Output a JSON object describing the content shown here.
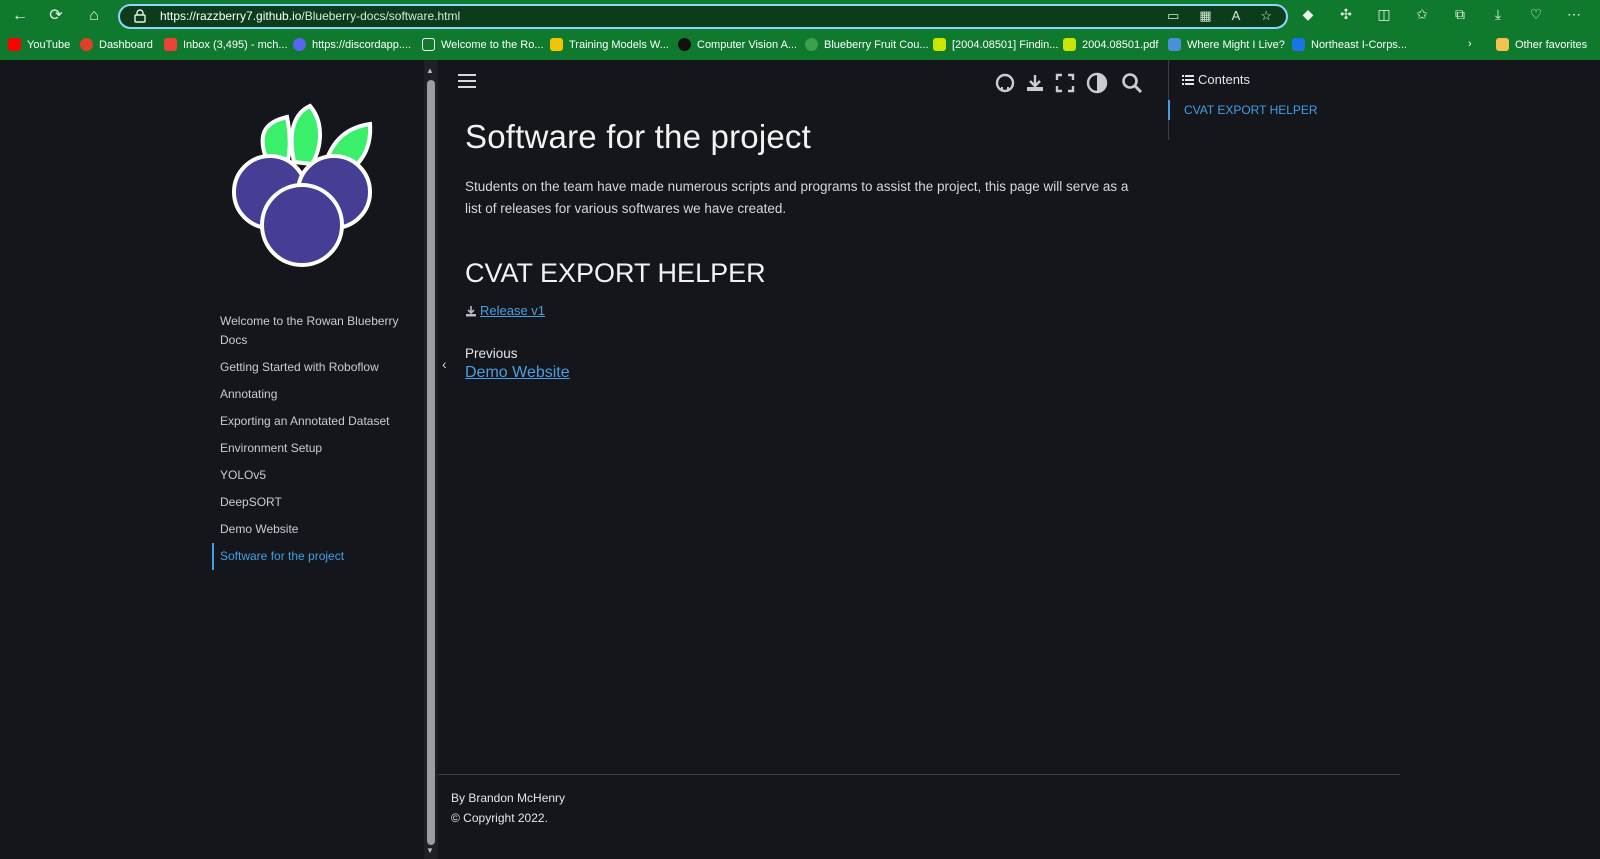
{
  "browser": {
    "url_host": "https://razzberry7.github.io",
    "url_path": "/Blueberry-docs/software.html"
  },
  "favorites": [
    {
      "label": "YouTube",
      "color": "#ff0000"
    },
    {
      "label": "Dashboard",
      "color": "#e0402a"
    },
    {
      "label": "Inbox (3,495) - mch...",
      "color": "#ea4335"
    },
    {
      "label": "https://discordapp....",
      "color": "#5865f2"
    },
    {
      "label": "Welcome to the Ro...",
      "color": "#ffffff"
    },
    {
      "label": "Training Models W...",
      "color": "#f5c400"
    },
    {
      "label": "Computer Vision A...",
      "color": "#111111"
    },
    {
      "label": "Blueberry Fruit Cou...",
      "color": "#3aa14a"
    },
    {
      "label": "[2004.08501] Findin...",
      "color": "#c8e600"
    },
    {
      "label": "2004.08501.pdf",
      "color": "#c8e600"
    },
    {
      "label": "Where Might I Live?",
      "color": "#4a90d9"
    },
    {
      "label": "Northeast I-Corps...",
      "color": "#1a73e8"
    },
    {
      "label": "Other favorites",
      "color": "#f2c14e"
    }
  ],
  "sidebar": {
    "items": [
      {
        "label": "Welcome to the Rowan Blueberry Docs"
      },
      {
        "label": "Getting Started with Roboflow"
      },
      {
        "label": "Annotating"
      },
      {
        "label": "Exporting an Annotated Dataset"
      },
      {
        "label": "Environment Setup"
      },
      {
        "label": "YOLOv5"
      },
      {
        "label": "DeepSORT"
      },
      {
        "label": "Demo Website"
      },
      {
        "label": "Software for the project"
      }
    ]
  },
  "main": {
    "title": "Software for the project",
    "intro": "Students on the team have made numerous scripts and programs to assist the project, this page will serve as a list of releases for various softwares we have created.",
    "section_title": "CVAT EXPORT HELPER",
    "release_link": "Release v1",
    "prev_label": "Previous",
    "prev_link": "Demo Website"
  },
  "right_toc": {
    "title": "Contents",
    "items": [
      "CVAT EXPORT HELPER"
    ]
  },
  "footer": {
    "author": "By Brandon McHenry",
    "copyright": "© Copyright 2022."
  },
  "colors": {
    "accent": "#3fa0e6",
    "browser_green": "#0f7a2d",
    "page_bg": "#14161b"
  }
}
